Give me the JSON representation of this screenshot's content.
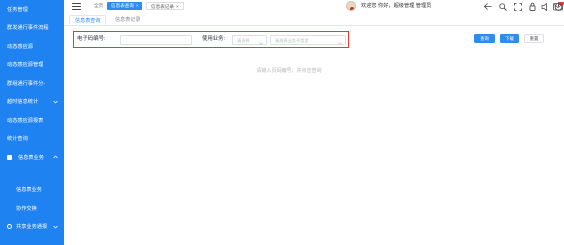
{
  "sidebar": {
    "items": [
      {
        "label": "任务管理",
        "chevron": false
      },
      {
        "label": "群发通行事件流程",
        "chevron": false
      },
      {
        "label": "动态感应源",
        "chevron": false
      },
      {
        "label": "动态感应源管理",
        "chevron": false
      },
      {
        "label": "群组通行事件分-",
        "chevron": false
      },
      {
        "label": "越时信息统计",
        "chevron": true
      },
      {
        "label": "动态感应源报表",
        "chevron": false
      },
      {
        "label": "统计查询",
        "chevron": false
      },
      {
        "label": "信息表业务",
        "chevron": true
      }
    ],
    "sub_items": [
      {
        "label": "信息表业务"
      },
      {
        "label": "协作交换"
      }
    ],
    "radio_item": {
      "label": "共享业务通报",
      "chevron": true
    }
  },
  "topbar": {
    "home_tab": "全页",
    "active_tab": "信息表查询",
    "other_tab": "信息表记录",
    "close_glyph": "×",
    "welcome": "欢迎您 你好，超级管理 管理员",
    "icons": [
      "arrow-left-icon",
      "search-icon",
      "expand-icon",
      "lock-icon",
      "notification-icon",
      "mail-icon",
      "power-icon"
    ],
    "badge_color": "#e53935"
  },
  "inner_tabs": {
    "first": "信息表查询",
    "second": "信息表记录"
  },
  "search": {
    "code_label": "电子码编号:",
    "code_value": "",
    "business_label": "使用业务:",
    "business_placeholder": "请选择",
    "detail_placeholder": "请选择业务子类型"
  },
  "buttons": {
    "query": "查询",
    "download": "下载",
    "reset": "重置"
  },
  "empty_hint": "请输入页码编号，并点击查询",
  "colors": {
    "sidebar": "#1e82f0",
    "primary": "#2d8cf0",
    "highlight_border": "#e53935"
  }
}
